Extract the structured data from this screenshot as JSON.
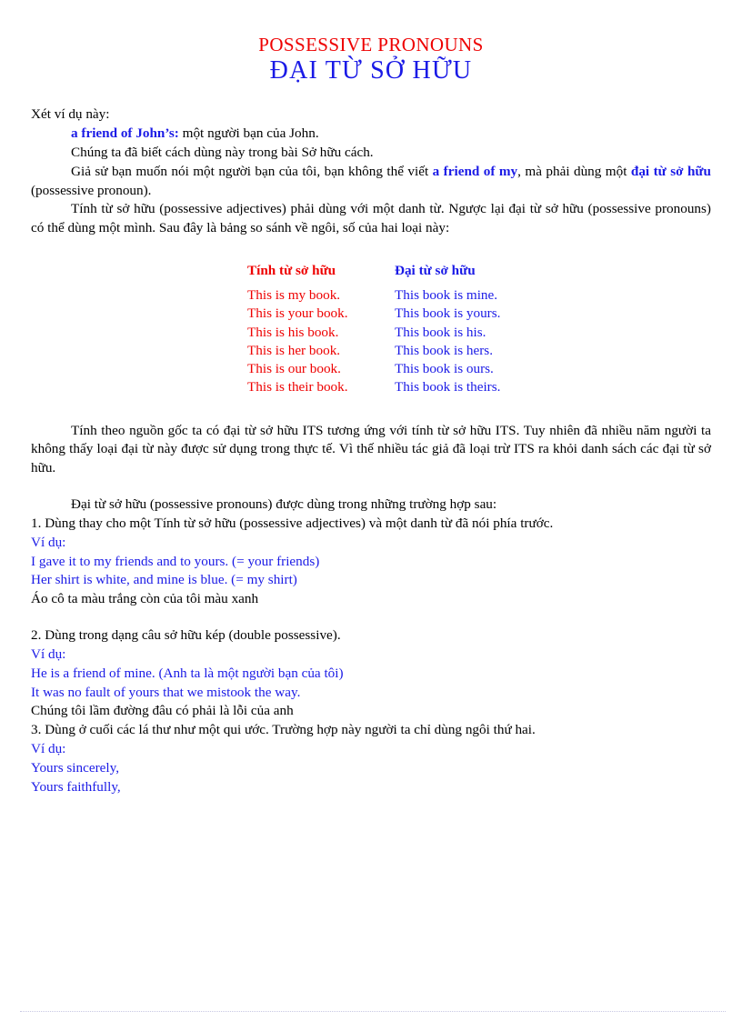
{
  "document": {
    "title_en": "POSSESSIVE PRONOUNS",
    "title_vi": "ĐẠI TỪ SỞ HỮU",
    "colors": {
      "red": "#ee0000",
      "blue": "#1a1ae6",
      "black": "#000000",
      "rule": "#c8c8e4"
    }
  },
  "intro": {
    "line1": "Xét ví dụ này:",
    "line2_bold": "a friend of John’s:",
    "line2_rest": " một người bạn của John.",
    "line3": "Chúng ta đã biết cách dùng này trong bài Sở hữu cách.",
    "line4_a": "Giả sử bạn muốn nói một người bạn của tôi, bạn không thể viết ",
    "line4_bold": "a friend of my",
    "line4_b": ", mà phải dùng một ",
    "line4_bold2": "đại từ sở hữu",
    "line4_c": " (possessive pronoun).",
    "para2": "Tính từ sở hữu (possessive adjectives) phải dùng với một danh từ. Ngược lại đại từ sở hữu (possessive pronouns) có thể dùng một mình. Sau đây là bảng so sánh về ngôi, số của hai loại này:"
  },
  "comparison": {
    "header_a": "Tính từ sở hữu",
    "header_b": "Đại từ sở hữu",
    "rows": [
      {
        "a": "This is my book.",
        "b": "This book is mine."
      },
      {
        "a": "This is your book.",
        "b": "This book is yours."
      },
      {
        "a": "This is his book.",
        "b": "This book is his."
      },
      {
        "a": "This is her book.",
        "b": "This book is hers."
      },
      {
        "a": "This is our book.",
        "b": "This book is ours."
      },
      {
        "a": "This is their book.",
        "b": "This book is theirs."
      }
    ]
  },
  "its_note": "Tính theo nguồn gốc ta có đại từ sở hữu ITS tương ứng với tính từ sở hữu ITS. Tuy nhiên đã nhiều năm người ta không thấy loại đại từ này được sử dụng trong thực tế. Vì thế nhiều tác giả đã loại trừ ITS ra khỏi danh sách các đại từ sở hữu.",
  "usage": {
    "lead": "Đại từ sở hữu (possessive pronouns) được dùng trong những trường hợp sau:",
    "item1": {
      "rule": "1. Dùng thay cho một Tính từ sở hữu (possessive adjectives) và một danh từ đã nói phía trước.",
      "vidu": "Ví dụ:",
      "ex1": "I gave it to my friends and to yours. (= your friends)",
      "ex2": "Her shirt is white, and mine is blue. (= my shirt)",
      "trans": "Áo cô ta màu trắng còn của tôi màu xanh"
    },
    "item2": {
      "rule": "2. Dùng trong dạng câu sở hữu kép (double possessive).",
      "vidu": "Ví dụ:",
      "ex1": "He is a friend of mine. (Anh ta là một người bạn của tôi)",
      "ex2": "It was no fault of yours that we mistook the way.",
      "trans": "  Chúng tôi lầm đường đâu có phải là lỗi của anh"
    },
    "item3": {
      "rule": "3. Dùng ở cuối các lá thư như một qui ước. Trường hợp này người ta chỉ dùng ngôi thứ hai.",
      "vidu": "Ví dụ:",
      "ex1": "Yours sincerely,",
      "ex2": "Yours faithfully,"
    }
  }
}
